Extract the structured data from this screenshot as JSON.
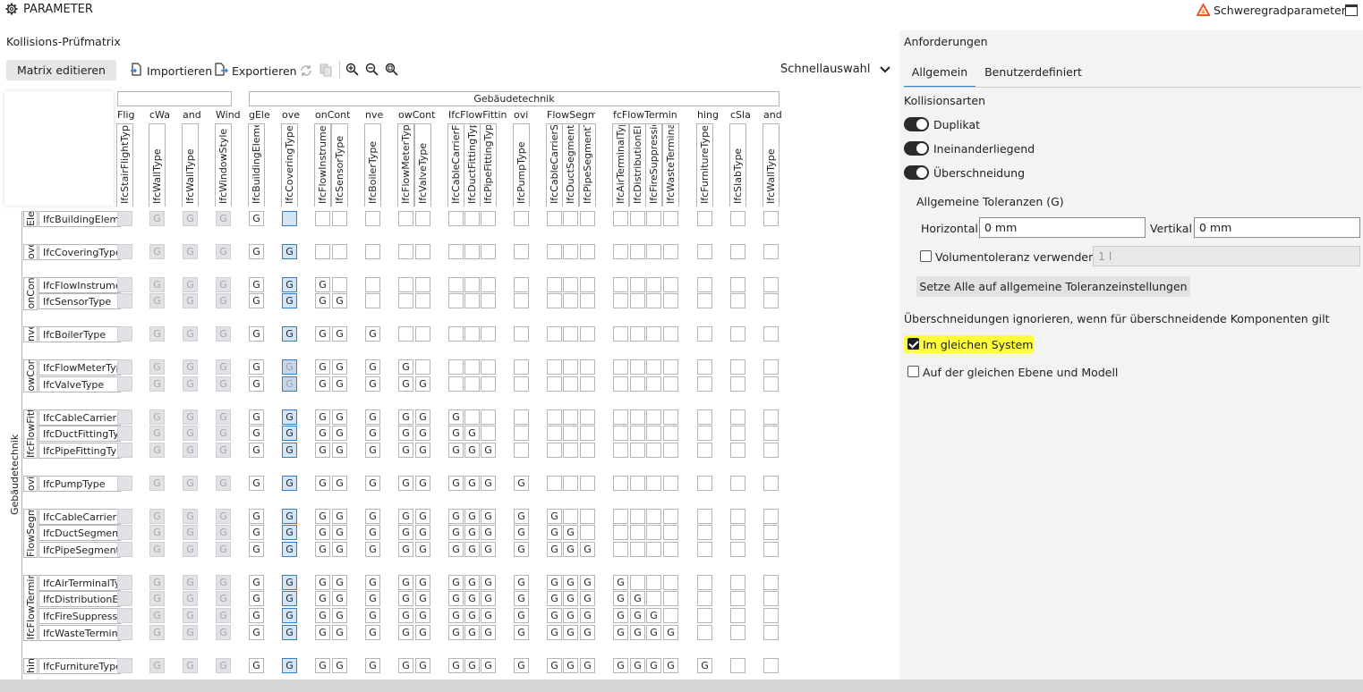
{
  "window": {
    "title": "PARAMETER",
    "right_link": "Schweregradparameter"
  },
  "matrix": {
    "title": "Kollisions-Prüfmatrix",
    "edit_button": "Matrix editieren",
    "import_label": "Importieren",
    "export_label": "Exportieren",
    "quick_select": "Schnellauswahl",
    "group_header": "Gebäudetechnik",
    "row_group_label": "Gebäudetechnik",
    "columns": [
      {
        "group": "Flig",
        "label": "IfcStairFlightType"
      },
      {
        "group": "cWa",
        "label": "IfcWallType"
      },
      {
        "group": "and",
        "label": "IfcWallType"
      },
      {
        "group": "Wind",
        "label": "IfcWindowStyle"
      },
      {
        "group": "gEle",
        "label": "IfcBuildingElemen"
      },
      {
        "group": "ove",
        "label": "IfcCoveringType"
      },
      {
        "group": "onCont",
        "label": "IfcFlowInstrumen"
      },
      {
        "group": "",
        "label": "IfcSensorType"
      },
      {
        "group": "nve",
        "label": "IfcBoilerType"
      },
      {
        "group": "owCont",
        "label": "IfcFlowMeterTyp"
      },
      {
        "group": "",
        "label": "IfcValveType"
      },
      {
        "group": "IfcFlowFittin",
        "label": "IfcCableCarrierFi"
      },
      {
        "group": "",
        "label": "IfcDuctFittingTyp"
      },
      {
        "group": "",
        "label": "IfcPipeFittingTyp"
      },
      {
        "group": "ovi",
        "label": "IfcPumpType"
      },
      {
        "group": "FlowSegme",
        "label": "IfcCableCarrierSe"
      },
      {
        "group": "",
        "label": "IfcDuctSegmentT"
      },
      {
        "group": "",
        "label": "IfcPipeSegmentT"
      },
      {
        "group": "fcFlowTermina",
        "label": "IfcAirTerminalTyp"
      },
      {
        "group": "",
        "label": "IfcDistributionEle"
      },
      {
        "group": "",
        "label": "IfcFireSuppressio"
      },
      {
        "group": "",
        "label": "IfcWasteTermina"
      },
      {
        "group": "hing",
        "label": "IfcFurnitureType"
      },
      {
        "group": "cSla",
        "label": "IfcSlabType"
      },
      {
        "group": "and",
        "label": "IfcWallType"
      }
    ],
    "row_groups": [
      {
        "label": "Ele",
        "rows": [
          "IfcBuildingEleme"
        ]
      },
      {
        "label": "ove",
        "rows": [
          "IfcCoveringType"
        ]
      },
      {
        "label": "onCont",
        "rows": [
          "IfcFlowInstrumen",
          "IfcSensorType"
        ]
      },
      {
        "label": "nve",
        "rows": [
          "IfcBoilerType"
        ]
      },
      {
        "label": "owCont",
        "rows": [
          "IfcFlowMeterType",
          "IfcValveType"
        ]
      },
      {
        "label": "IfcFlowFittin",
        "rows": [
          "IfcCableCarrierFit",
          "IfcDuctFittingTyp",
          "IfcPipeFittingTyp"
        ]
      },
      {
        "label": "ovi",
        "rows": [
          "IfcPumpType"
        ]
      },
      {
        "label": "FlowSegme",
        "rows": [
          "IfcCableCarrierSe",
          "IfcDuctSegmentT",
          "IfcPipeSegmentT"
        ]
      },
      {
        "label": "IfcFlowTermina",
        "rows": [
          "IfcAirTerminalTyp",
          "IfcDistributionEle",
          "IfcFireSuppressio",
          "IfcWasteTerminal"
        ]
      },
      {
        "label": "hing",
        "rows": [
          "IfcFurnitureType"
        ]
      }
    ],
    "cell_value": "G"
  },
  "requirements": {
    "title": "Anforderungen",
    "tabs": [
      "Allgemein",
      "Benutzerdefiniert"
    ],
    "collision_types_title": "Kollisionsarten",
    "toggles": [
      "Duplikat",
      "Ineinanderliegend",
      "Überschneidung"
    ],
    "tolerances_title": "Allgemeine Toleranzen (G)",
    "horizontal_label": "Horizontal",
    "horizontal_value": "0 mm",
    "vertical_label": "Vertikal",
    "vertical_value": "0 mm",
    "volume_label": "Volumentoleranz verwenden",
    "volume_value": "1 l",
    "apply_all_button": "Setze Alle auf allgemeine Toleranzeinstellungen",
    "ignore_title": "Überschneidungen ignorieren, wenn für überschneidende Komponenten gilt",
    "same_system_label": "Im gleichen System",
    "same_level_label": "Auf der gleichen Ebene und Modell"
  },
  "colors": {
    "accent": "#2e7fd1",
    "highlight": "#ffff3a",
    "warning": "#e8572a"
  }
}
